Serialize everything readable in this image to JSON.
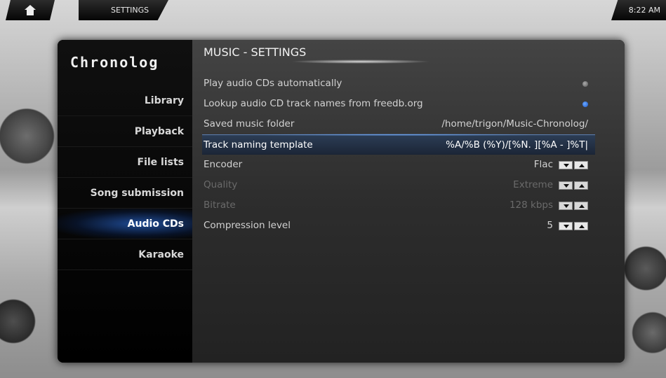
{
  "topbar": {
    "breadcrumb": "SETTINGS",
    "clock": "8:22 AM"
  },
  "sidebar": {
    "logo": "Chronolog",
    "items": [
      {
        "label": "Library"
      },
      {
        "label": "Playback"
      },
      {
        "label": "File lists"
      },
      {
        "label": "Song submission"
      },
      {
        "label": "Audio CDs"
      },
      {
        "label": "Karaoke"
      }
    ],
    "active_index": 4
  },
  "main": {
    "title": "MUSIC - SETTINGS",
    "settings": [
      {
        "label": "Play audio CDs automatically",
        "value": "",
        "control": "radio",
        "checked": false
      },
      {
        "label": "Lookup audio CD track names from freedb.org",
        "value": "",
        "control": "radio",
        "checked": true
      },
      {
        "label": "Saved music folder",
        "value": "/home/trigon/Music-Chronolog/",
        "control": "text"
      },
      {
        "label": "Track naming template",
        "value": "%A/%B (%Y)/[%N. ][%A - ]%T|",
        "control": "text",
        "focused": true
      },
      {
        "label": "Encoder",
        "value": "Flac",
        "control": "spinner"
      },
      {
        "label": "Quality",
        "value": "Extreme",
        "control": "spinner",
        "disabled": true
      },
      {
        "label": "Bitrate",
        "value": "128 kbps",
        "control": "spinner",
        "disabled": true
      },
      {
        "label": "Compression level",
        "value": "5",
        "control": "spinner"
      }
    ]
  },
  "colors": {
    "accent": "#2a6fe0",
    "panel": "#000000"
  }
}
